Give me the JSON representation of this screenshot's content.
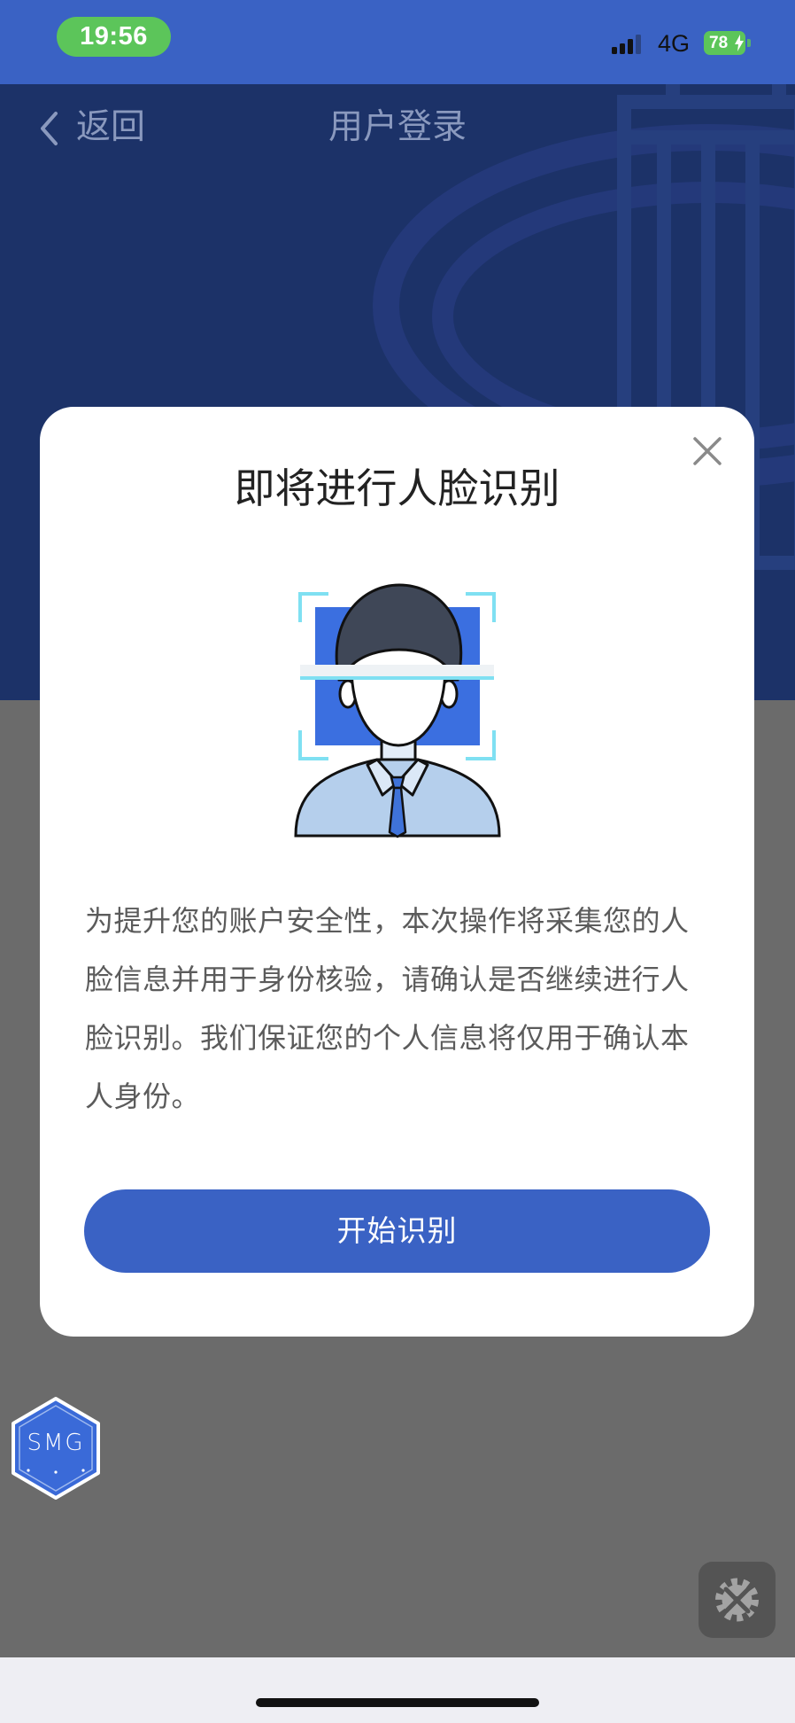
{
  "status_bar": {
    "time": "19:56",
    "network": "4G",
    "battery": "78",
    "signal_icon": "signal-bars-icon",
    "battery_icon": "battery-charging-icon"
  },
  "nav": {
    "back_label": "返回",
    "back_icon": "chevron-left-icon",
    "title": "用户登录"
  },
  "dialog": {
    "title": "即将进行人脸识别",
    "illustration": "face-scan-icon",
    "message": "为提升您的账户安全性，本次操作将采集您的人脸信息并用于身份核验，请确认是否继续进行人脸识别。我们保证您的个人信息将仅用于确认本人身份。",
    "primary_button": "开始识别",
    "close_icon": "close-icon"
  },
  "floating": {
    "logo_text": "SMG",
    "tools_icon": "gear-tools-icon"
  },
  "colors": {
    "accent": "#3a62c4",
    "status_green": "#5cc55a",
    "header_dimmed": "#1c3268",
    "backdrop": "#6b6b6b",
    "scan_cyan": "#7fe0f2"
  }
}
